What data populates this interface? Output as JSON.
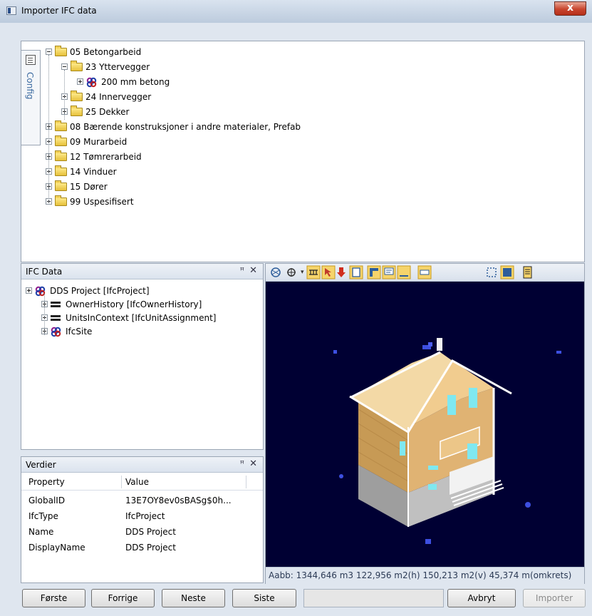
{
  "window": {
    "title": "Importer IFC data",
    "close_glyph": "x"
  },
  "config_tab": {
    "label": "Config"
  },
  "top_tree": [
    {
      "label": "05 Betongarbeid",
      "level": 0,
      "expanded": true,
      "icon": "folder-icon"
    },
    {
      "label": "23 Yttervegger",
      "level": 1,
      "expanded": true,
      "icon": "folder-icon"
    },
    {
      "label": "200 mm betong",
      "level": 2,
      "expanded": false,
      "icon": "ifc-object-icon"
    },
    {
      "label": "24 Innervegger",
      "level": 1,
      "expanded": false,
      "icon": "folder-icon"
    },
    {
      "label": "25 Dekker",
      "level": 1,
      "expanded": false,
      "icon": "folder-icon"
    },
    {
      "label": "08 Bærende konstruksjoner i andre materialer, Prefab",
      "level": 0,
      "expanded": false,
      "icon": "folder-icon"
    },
    {
      "label": "09 Murarbeid",
      "level": 0,
      "expanded": false,
      "icon": "folder-icon"
    },
    {
      "label": "12 Tømrerarbeid",
      "level": 0,
      "expanded": false,
      "icon": "folder-icon"
    },
    {
      "label": "14 Vinduer",
      "level": 0,
      "expanded": false,
      "icon": "folder-icon"
    },
    {
      "label": "15 Dører",
      "level": 0,
      "expanded": false,
      "icon": "folder-icon"
    },
    {
      "label": "99 Uspesifisert",
      "level": 0,
      "expanded": false,
      "icon": "folder-icon"
    }
  ],
  "ifc_panel": {
    "title": "IFC Data",
    "pin_glyph": "ꟸ",
    "close_glyph": "✕",
    "tree": [
      {
        "label": "DDS Project [IfcProject]",
        "level": 0,
        "icon": "ifc-object-icon"
      },
      {
        "label": "OwnerHistory [IfcOwnerHistory]",
        "level": 1,
        "icon": "equals-icon"
      },
      {
        "label": "UnitsInContext [IfcUnitAssignment]",
        "level": 1,
        "icon": "equals-icon"
      },
      {
        "label": "IfcSite",
        "level": 1,
        "icon": "ifc-object-icon"
      }
    ]
  },
  "values_panel": {
    "title": "Verdier",
    "pin_glyph": "ꟸ",
    "close_glyph": "✕",
    "columns": [
      "Property",
      "Value"
    ],
    "rows": [
      [
        "GlobalID",
        "13E7OY8ev0sBASg$0h..."
      ],
      [
        "IfcType",
        "IfcProject"
      ],
      [
        "Name",
        "DDS Project"
      ],
      [
        "DisplayName",
        "DDS Project"
      ]
    ]
  },
  "viewer": {
    "status": "Aabb: 1344,646 m3   122,956 m2(h)   150,213 m2(v)   45,374 m(omkrets)",
    "background": "#000033"
  },
  "buttons": {
    "first": "Første",
    "prev": "Forrige",
    "next": "Neste",
    "last": "Siste",
    "cancel": "Avbryt",
    "import": "Importer"
  }
}
